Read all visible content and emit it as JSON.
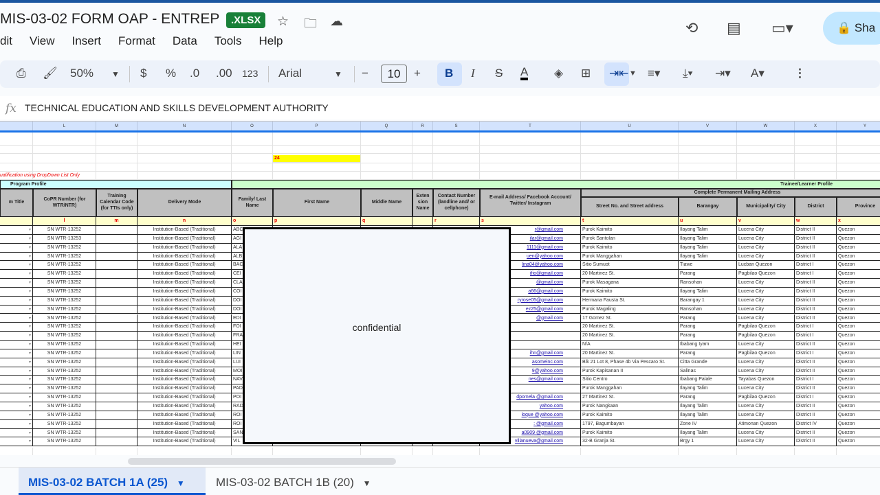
{
  "doc": {
    "title": "MIS-03-02 FORM OAP - ENTREP",
    "badge": ".XLSX",
    "share": "Sha"
  },
  "menu": [
    "dit",
    "View",
    "Insert",
    "Format",
    "Data",
    "Tools",
    "Help"
  ],
  "toolbar": {
    "zoom": "50%",
    "currency": "$",
    "percent": "%",
    "dec_less": ".0",
    "dec_more": ".00",
    "format_num": "123",
    "font": "Arial",
    "font_size": "10",
    "minus": "−",
    "plus": "+",
    "bold": "B",
    "italic": "I"
  },
  "formula": {
    "fx": "fx",
    "value": "TECHNICAL EDUCATION AND SKILLS DEVELOPMENT AUTHORITY"
  },
  "columns": [
    "",
    "L",
    "M",
    "N",
    "O",
    "P",
    "Q",
    "R",
    "S",
    "T",
    "U",
    "V",
    "W",
    "X",
    "Y"
  ],
  "sheet": {
    "yellow_value": "24",
    "note": "ualification using DropDown List Only",
    "program_profile": "Program Profile",
    "trainee_profile": "Trainee/Learner Profile",
    "address_group": "Complete Permanent Mailing Address",
    "headers": [
      "m Title",
      "CoPR Number (for WTR/NTR)",
      "Training Calendar Code (for TTIs only)",
      "Delivery Mode",
      "Family/ Last Name",
      "First Name",
      "Middle Name",
      "Exten sion Name",
      "Contact Number (landline and/ or cellphone)",
      "E-mail Address/ Facebook Account/ Twitter/ Instagram",
      "Street No. and  Street address",
      "Barangay",
      "Municipality/ City",
      "District",
      "Province"
    ],
    "letters": [
      "",
      "l",
      "m",
      "n",
      "o",
      "p",
      "q",
      "",
      "r",
      "s",
      "t",
      "u",
      "v",
      "w",
      "x"
    ],
    "delivery_mode": "Institution-Based (Traditional)",
    "rows": [
      [
        "SN WTR-13252",
        "ABC",
        "r@gmail.com",
        "Purok Kaimito",
        "Ilayang Talim",
        "Lucena City",
        "District II",
        "Quezon"
      ],
      [
        "SN WTR-13253",
        "AGI",
        "ilar@gmail.com",
        "Purok Santolan",
        "Ilayang Talim",
        "Lucena City",
        "District II",
        "Quezon"
      ],
      [
        "SN WTR-13252",
        "ALA",
        "1111@gmail.com",
        "Purok Kaimito",
        "Ilayang Talim",
        "Lucena City",
        "District II",
        "Quezon"
      ],
      [
        "SN WTR-13252",
        "ALB",
        "uen@yahoo.com",
        "Purok Manggahan",
        "Ilayang Talim",
        "Lucena City",
        "District II",
        "Quezon"
      ],
      [
        "SN WTR-13252",
        "BAC",
        "lina04@yahoo.com",
        "Sitio Sumuot",
        "Tiawe",
        "Lucban Quezon",
        "District I",
        "Quezon"
      ],
      [
        "SN WTR-13252",
        "CEI",
        "ifio@gmail.com",
        "20 Martinez St.",
        "Parang",
        "Pagbilao Quezon",
        "District I",
        "Quezon"
      ],
      [
        "SN WTR-13252",
        "CLA",
        "@gmail.com",
        "Purok Masagana",
        "Ransohan",
        "Lucena City",
        "District II",
        "Quezon"
      ],
      [
        "SN WTR-13252",
        "COI",
        "a66@gmail.com",
        "Purok Kaimito",
        "Ilayang Talim",
        "Lucena City",
        "District II",
        "Quezon"
      ],
      [
        "SN WTR-13252",
        "DOI",
        "ryrose05@gmail.com",
        "Hermana Fausta St.",
        "Barangay 1",
        "Lucena City",
        "District II",
        "Quezon"
      ],
      [
        "SN WTR-13252",
        "DOI",
        "ez25@gmail.com",
        "Purok Magaling",
        "Ransohan",
        "Lucena City",
        "District II",
        "Quezon"
      ],
      [
        "SN WTR-13252",
        "EDI",
        "@gmail.com",
        "17 Gomez St.",
        "Parang",
        "Lucena City",
        "District II",
        "Quezon"
      ],
      [
        "SN WTR-13252",
        "FOI",
        "",
        "20 Martinez St.",
        "Parang",
        "Pagbilao Quezon",
        "District I",
        "Quezon"
      ],
      [
        "SN WTR-13252",
        "FRA",
        "",
        "20 Martinez St.",
        "Parang",
        "Pagbilao Quezon",
        "District I",
        "Quezon"
      ],
      [
        "SN WTR-13252",
        "HEI",
        "",
        "N/A",
        "Ibabang Iyam",
        "Lucena City",
        "District II",
        "Quezon"
      ],
      [
        "SN WTR-13252",
        "LIN",
        "ihn@gmail.com",
        "20 Martinez St.",
        "Parang",
        "Pagbilao Quezon",
        "District I",
        "Quezon"
      ],
      [
        "SN WTR-13252",
        "LUI",
        "asomeinc.com",
        "Blk 21 Lot 8, Phase 4b Via Pescaro St.",
        "Citta Grande",
        "Lucena City",
        "District II",
        "Quezon"
      ],
      [
        "SN WTR-13252",
        "MOI",
        "9@yahoo.com",
        "Purok Kapisanan II",
        "Salinas",
        "Lucena City",
        "District II",
        "Quezon"
      ],
      [
        "SN WTR-13252",
        "NAV",
        "nes@gmail.com",
        "Sitio Centro",
        "Ibabang Palale",
        "Tayabas Quezon",
        "District I",
        "Quezon"
      ],
      [
        "SN WTR-13252",
        "PAD",
        "",
        "Purok Manggahan",
        "Ilayang Talim",
        "Lucena City",
        "District II",
        "Quezon"
      ],
      [
        "SN WTR-13252",
        "POI",
        "dpomela @gmail.com",
        "27 Martinez St.",
        "Parang",
        "Pagbilao Quezon",
        "District I",
        "Quezon"
      ],
      [
        "SN WTR-13252",
        "RAD",
        "yahoo.com",
        "Purok Nangkaan",
        "Ilayang Talim",
        "Lucena City",
        "District II",
        "Quezon"
      ],
      [
        "SN WTR-13252",
        "ROI",
        "loque @yahoo.com",
        "Purok Kaimito",
        "Ilayang Talim",
        "Lucena City",
        "District II",
        "Quezon"
      ],
      [
        "SN WTR-13252",
        "ROI",
        ": @gmail.com",
        "1797, Bagumbayan",
        "Zone IV",
        "Atimonan Quezon",
        "District IV",
        "Quezon"
      ],
      [
        "SN WTR-13252",
        "SAN",
        "a0909 @gmail.com",
        "Purok Kaimito",
        "Ilayang Talim",
        "Lucena City",
        "District II",
        "Quezon"
      ],
      [
        "SN WTR-13252",
        "VIL",
        "villanueva@gmail.com",
        "32-B Granja St.",
        "Brgy 1",
        "Lucena City",
        "District II",
        "Quezon"
      ]
    ]
  },
  "overlay": {
    "text": "confidential"
  },
  "tabs": [
    {
      "label": "MIS-03-02 BATCH 1A (25)",
      "active": true
    },
    {
      "label": "MIS-03-02 BATCH 1B (20)",
      "active": false
    }
  ],
  "colors": {
    "header_gray": "#c0c0c0",
    "letter_row": "#ffffcc",
    "program_band": "#ccffff",
    "trainee_band": "#ccffcc",
    "highlight": "#ffff00",
    "active_tab": "#0b57d0"
  }
}
